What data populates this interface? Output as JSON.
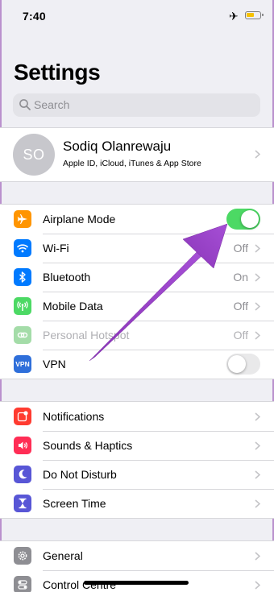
{
  "status_bar": {
    "time": "7:40",
    "airplane_glyph": "✈",
    "icons": [
      "airplane-icon",
      "battery-icon"
    ]
  },
  "page": {
    "title": "Settings"
  },
  "search": {
    "placeholder": "Search"
  },
  "profile": {
    "initials": "SO",
    "name": "Sodiq Olanrewaju",
    "subtitle": "Apple ID, iCloud, iTunes & App Store"
  },
  "connectivity": [
    {
      "label": "Airplane Mode",
      "icon": "airplane-icon",
      "color": "#ff9500",
      "control": "toggle",
      "state": "on"
    },
    {
      "label": "Wi-Fi",
      "icon": "wifi-icon",
      "color": "#007aff",
      "value": "Off"
    },
    {
      "label": "Bluetooth",
      "icon": "bluetooth-icon",
      "color": "#007aff",
      "value": "On"
    },
    {
      "label": "Mobile Data",
      "icon": "antenna-icon",
      "color": "#4cd964",
      "value": "Off"
    },
    {
      "label": "Personal Hotspot",
      "icon": "link-icon",
      "color": "#a4dca8",
      "value": "Off",
      "disabled": true
    },
    {
      "label": "VPN",
      "icon": "vpn-icon",
      "icon_text": "VPN",
      "color": "#2f6fda",
      "control": "toggle",
      "state": "off"
    }
  ],
  "notifications_group": [
    {
      "label": "Notifications",
      "icon": "notifications-icon",
      "color": "#ff3b30"
    },
    {
      "label": "Sounds & Haptics",
      "icon": "speaker-icon",
      "color": "#ff2d55"
    },
    {
      "label": "Do Not Disturb",
      "icon": "moon-icon",
      "color": "#5856d6"
    },
    {
      "label": "Screen Time",
      "icon": "hourglass-icon",
      "color": "#5856d6"
    }
  ],
  "general_group": [
    {
      "label": "General",
      "icon": "gear-icon",
      "color": "#8e8e93"
    },
    {
      "label": "Control Centre",
      "icon": "toggles-icon",
      "color": "#8e8e93"
    }
  ],
  "colors": {
    "accent_green": "#4cd964",
    "arrow_purple": "#9b3fc6"
  }
}
